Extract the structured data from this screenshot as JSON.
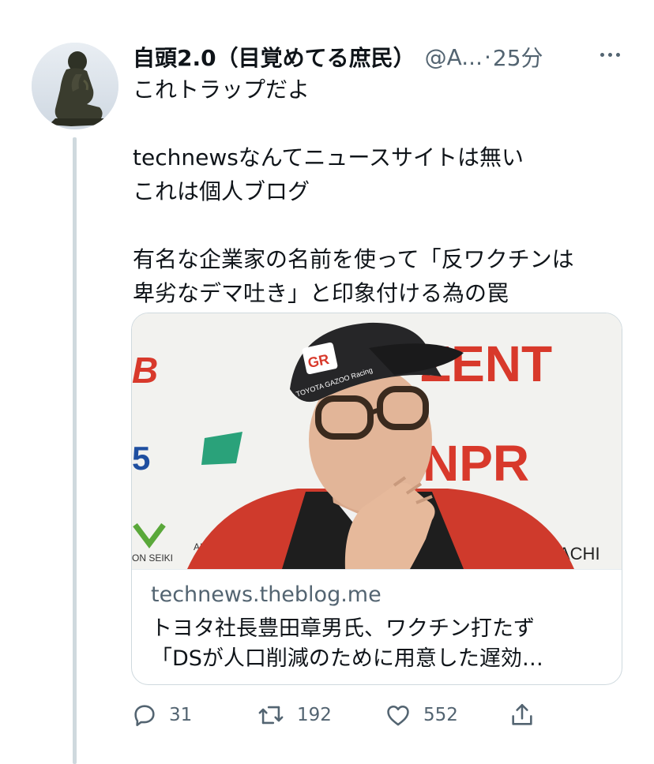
{
  "tweet": {
    "author_name": "自頭2.0（目覚めてる庶民）",
    "handle": "@A...",
    "separator": "·",
    "time": "25分",
    "text_lines": [
      "これトラップだよ",
      "",
      "technewsなんてニュースサイトは無い",
      "これは個人ブログ",
      "",
      "有名な企業家の名前を使って「反ワクチンは",
      "卑劣なデマ吐き」と印象付ける為の罠"
    ]
  },
  "card": {
    "image_signage": {
      "cap_logo": "GR",
      "cap_text": "TOYOTA GAZOO Racing",
      "sign_zent": "ZENT",
      "sign_npr": "NPR",
      "sign_b": "B",
      "sign_5": "5",
      "sign_achi": "ACHI",
      "sign_on_seiki": "ON SEIKI",
      "sign_aisin": "AISIN"
    },
    "domain": "technews.theblog.me",
    "title_lines": [
      "トヨタ社長豊田章男氏、ワクチン打たず",
      "「DSが人口削減のために用意した遅効…"
    ]
  },
  "actions": {
    "reply_count": "31",
    "retweet_count": "192",
    "like_count": "552"
  },
  "colors": {
    "text_primary": "#0f1419",
    "text_secondary": "#536471",
    "border": "#cfd9de",
    "sign_red": "#d8392b"
  },
  "icons": [
    "more-icon",
    "reply-icon",
    "retweet-icon",
    "like-icon",
    "share-icon"
  ]
}
